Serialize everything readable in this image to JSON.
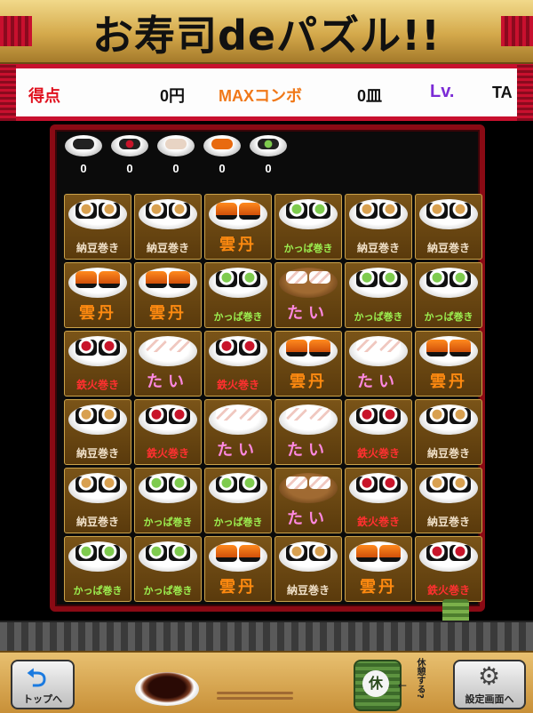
{
  "title": "お寿司deパズル!!",
  "scoreboard": {
    "score_label": "得点",
    "score_value": "0円",
    "combo_label": "MAXコンボ",
    "combo_value": "0皿",
    "level_label": "Lv.",
    "level_value": "TA"
  },
  "counters": [
    {
      "icon": "natto-maki-icon",
      "count": "0"
    },
    {
      "icon": "tekka-maki-icon",
      "count": "0"
    },
    {
      "icon": "tai-icon",
      "count": "0"
    },
    {
      "icon": "uni-icon",
      "count": "0"
    },
    {
      "icon": "kappa-maki-icon",
      "count": "0"
    }
  ],
  "board": [
    [
      "納豆巻き",
      "納豆巻き",
      "雲丹",
      "かっぱ巻き",
      "納豆巻き",
      "納豆巻き"
    ],
    [
      "雲丹",
      "雲丹",
      "かっぱ巻き",
      "たい",
      "かっぱ巻き",
      "かっぱ巻き"
    ],
    [
      "鉄火巻き",
      "たい",
      "鉄火巻き",
      "雲丹",
      "たい",
      "雲丹"
    ],
    [
      "納豆巻き",
      "鉄火巻き",
      "たい",
      "たい",
      "鉄火巻き",
      "納豆巻き"
    ],
    [
      "納豆巻き",
      "かっぱ巻き",
      "かっぱ巻き",
      "たい",
      "鉄火巻き",
      "納豆巻き"
    ],
    [
      "かっぱ巻き",
      "かっぱ巻き",
      "雲丹",
      "納豆巻き",
      "雲丹",
      "鉄火巻き"
    ]
  ],
  "bottom": {
    "top_button_label": "トップへ",
    "top_icon_glyph": "⮌",
    "rest_icon_glyph": "休",
    "rest_label": "休憩する?",
    "settings_button_label": "設定画面へ",
    "settings_icon_glyph": "⚙"
  },
  "colors": {
    "frame_red": "#8a0a14",
    "score_label": "#e0101e",
    "combo_label": "#f07818",
    "level_label": "#7b2bd6"
  }
}
